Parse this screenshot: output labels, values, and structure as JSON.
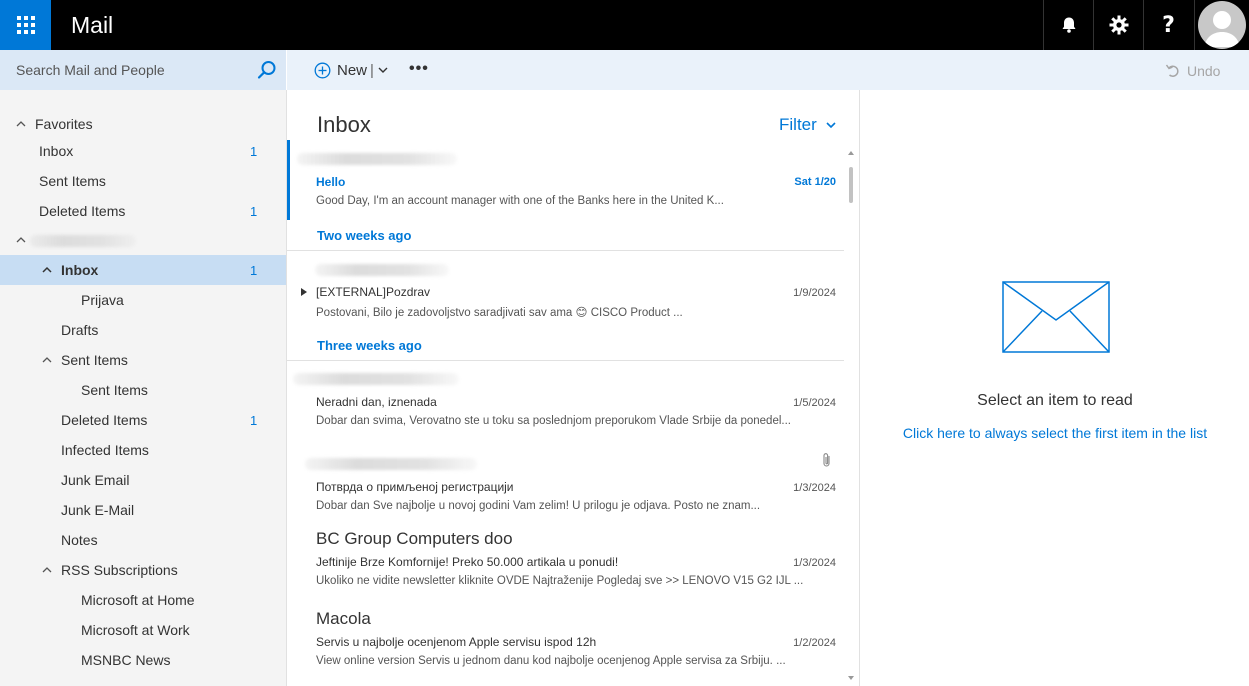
{
  "header": {
    "app_title": "Mail",
    "icons": [
      "app-launcher-icon",
      "bell-icon",
      "gear-icon",
      "help-icon",
      "avatar"
    ],
    "accent_color": "#0078d7"
  },
  "search": {
    "placeholder": "Search Mail and People"
  },
  "commands": {
    "new_label": "New",
    "new_sep": "|",
    "more_label": "•••",
    "undo_label": "Undo"
  },
  "nav": {
    "favorites_label": "Favorites",
    "favorites": [
      {
        "label": "Inbox",
        "count": "1"
      },
      {
        "label": "Sent Items",
        "count": ""
      },
      {
        "label": "Deleted Items",
        "count": "1"
      }
    ],
    "folders": [
      {
        "label": "Inbox",
        "count": "1"
      },
      {
        "label": "Prijava",
        "count": ""
      },
      {
        "label": "Drafts",
        "count": ""
      },
      {
        "label": "Sent Items",
        "count": ""
      },
      {
        "label": "Sent Items",
        "count": ""
      },
      {
        "label": "Deleted Items",
        "count": "1"
      },
      {
        "label": "Infected Items",
        "count": ""
      },
      {
        "label": "Junk Email",
        "count": ""
      },
      {
        "label": "Junk E-Mail",
        "count": ""
      },
      {
        "label": "Notes",
        "count": ""
      },
      {
        "label": "RSS Subscriptions",
        "count": ""
      },
      {
        "label": "Microsoft at Home",
        "count": ""
      },
      {
        "label": "Microsoft at Work",
        "count": ""
      },
      {
        "label": "MSNBC News",
        "count": ""
      }
    ]
  },
  "list": {
    "title": "Inbox",
    "filter_label": "Filter",
    "groups": [
      "Two weeks ago",
      "Three weeks ago"
    ],
    "messages": [
      {
        "sender": "",
        "subject": "Hello",
        "date": "Sat 1/20",
        "preview": "Good Day, I'm                     an account manager with one of the Banks here in the United K...",
        "unread": true
      },
      {
        "sender": "",
        "subject": "[EXTERNAL]Pozdrav",
        "date": "1/9/2024",
        "preview": "Postovani,            Bilo je zadovoljstvo saradjivati sav ama 😊                          CISCO Product ..."
      },
      {
        "sender": "",
        "subject": "Neradni dan, iznenada",
        "date": "1/5/2024",
        "preview": "Dobar dan svima, Verovatno ste u toku sa poslednjom preporukom Vlade Srbije da ponedel..."
      },
      {
        "sender": "",
        "subject": "Потврда о примљеној регистрацији",
        "date": "1/3/2024",
        "preview": "Dobar dan            Sve najbolje u novoj godini Vam zelim! U prilogu je odjava. Posto ne znam..."
      },
      {
        "sender": "BC Group Computers doo",
        "subject": "Jeftinije Brze Komfornije! Preko 50.000 artikala u ponudi!",
        "date": "1/3/2024",
        "preview": "Ukoliko ne vidite newsletter kliknite OVDE Najtraženije Pogledaj sve >> LENOVO V15 G2 IJL ..."
      },
      {
        "sender": "Macola",
        "subject": "Servis u najbolje ocenjenom Apple servisu ispod 12h",
        "date": "1/2/2024",
        "preview": "View online version Servis u jednom danu kod najbolje ocenjenog Apple servisa za Srbiju. ..."
      }
    ]
  },
  "reading": {
    "title": "Select an item to read",
    "link": "Click here to always select the first item in the list"
  }
}
